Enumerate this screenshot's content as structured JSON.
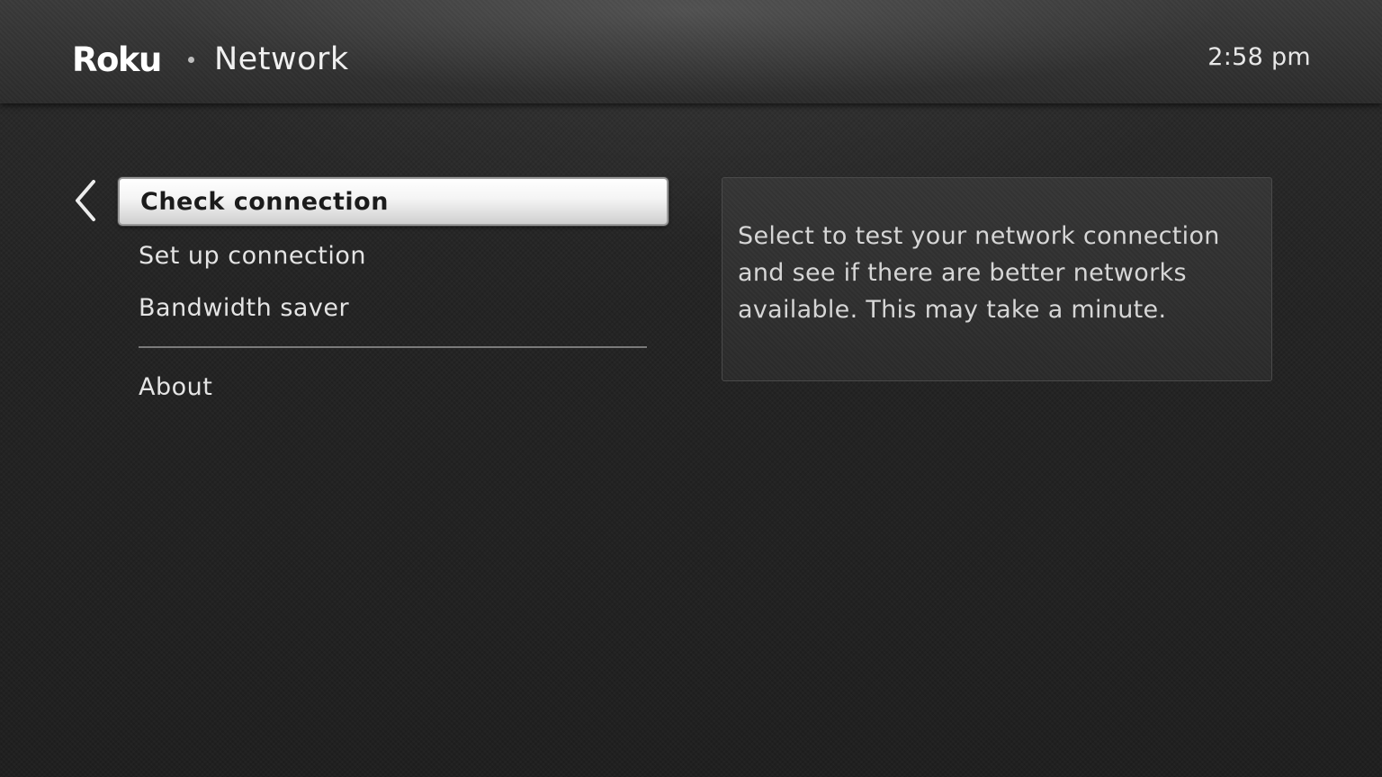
{
  "header": {
    "logo_text": "Roku",
    "title": "Network",
    "time": "2:58 pm"
  },
  "menu": {
    "items": [
      {
        "label": "Check connection",
        "selected": true
      },
      {
        "label": "Set up connection",
        "selected": false
      },
      {
        "label": "Bandwidth saver",
        "selected": false
      }
    ],
    "secondary_items": [
      {
        "label": "About",
        "selected": false
      }
    ]
  },
  "info_panel": {
    "text": "Select to test your network connection and see if there are better networks available. This may take a minute."
  },
  "icons": {
    "back": "chevron-left-icon",
    "separator": "dot-separator"
  },
  "colors": {
    "background": "#232323",
    "header": "#333333",
    "selection_highlight": "#f4f4f4",
    "selected_text": "#1b1b1b",
    "text": "#e4e4e4"
  }
}
